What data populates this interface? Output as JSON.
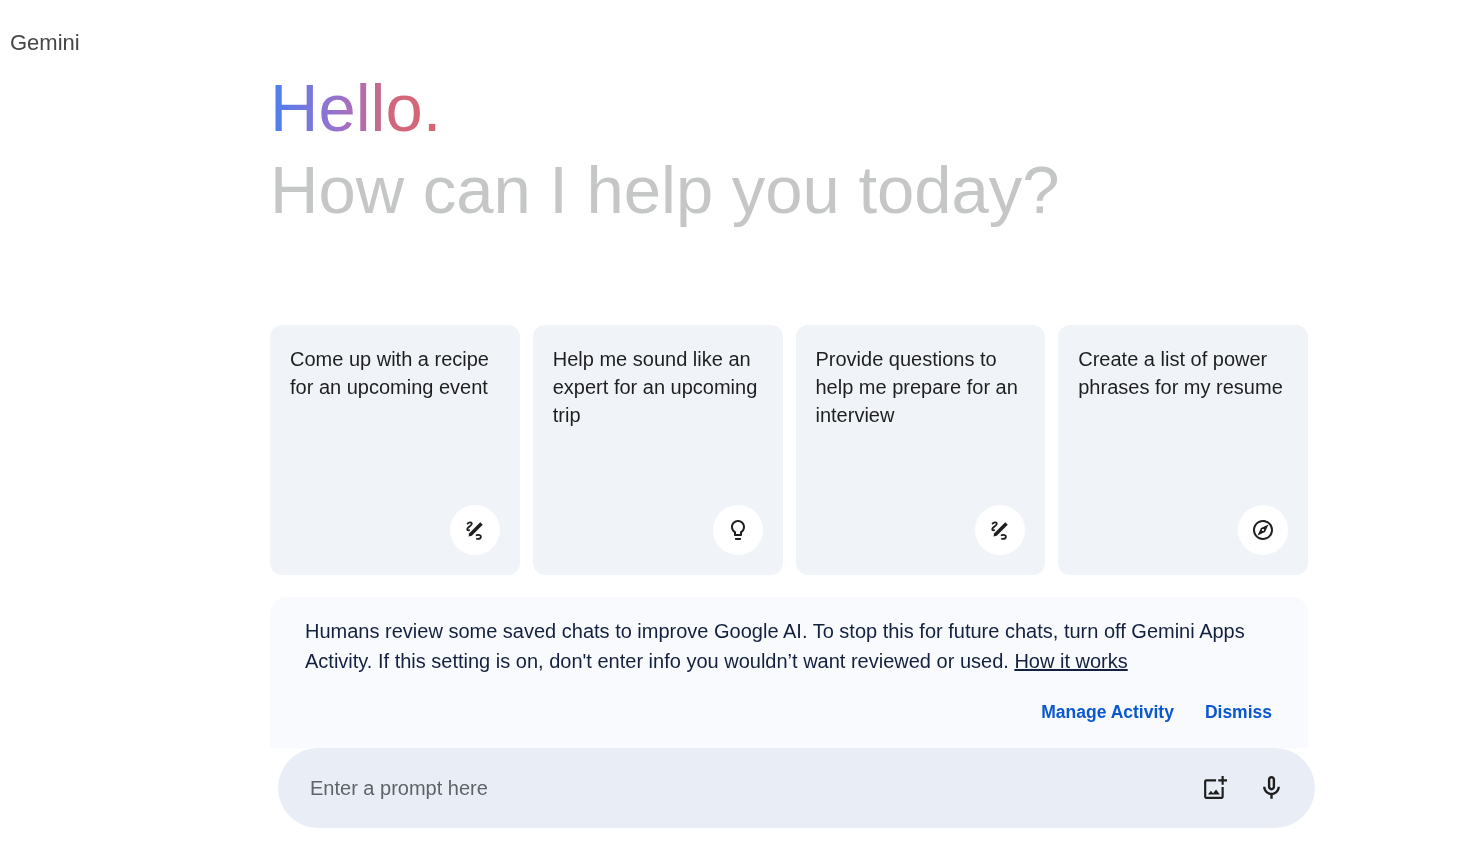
{
  "app": {
    "title": "Gemini"
  },
  "greeting": {
    "headline": "Hello.",
    "subtitle": "How can I help you today?"
  },
  "suggestions": [
    {
      "text": "Come up with a recipe for an upcoming event",
      "kind": "write"
    },
    {
      "text": "Help me sound like an expert for an upcoming trip",
      "kind": "learn"
    },
    {
      "text": "Provide questions to help me prepare for an interview",
      "kind": "write"
    },
    {
      "text": "Create a list of power phrases for my resume",
      "kind": "explore"
    }
  ],
  "notice": {
    "text": "Humans review some saved chats to improve Google AI. To stop this for future chats, turn off Gemini Apps Activity. If this setting is on, don't enter info you wouldn’t want reviewed or used.",
    "link": "How it works",
    "buttons": [
      "Manage Activity",
      "Dismiss"
    ]
  },
  "prompt": {
    "placeholder": "Enter a prompt here"
  }
}
